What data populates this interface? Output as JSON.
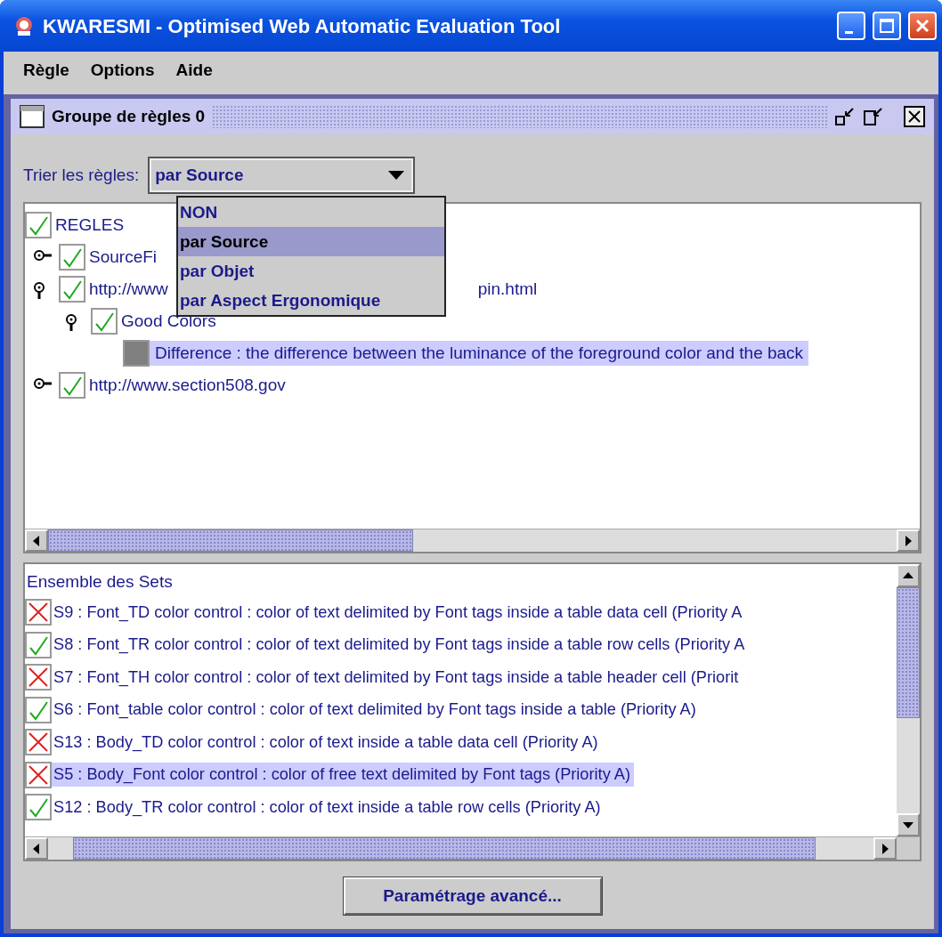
{
  "window": {
    "title": "KWARESMI - Optimised Web Automatic Evaluation Tool"
  },
  "menu": [
    "Règle",
    "Options",
    "Aide"
  ],
  "frame": {
    "title": "Groupe de règles 0"
  },
  "sort": {
    "label": "Trier les règles:",
    "value": "par Source",
    "expanded": true,
    "options": [
      {
        "label": "NON",
        "selected": false
      },
      {
        "label": "par Source",
        "selected": true
      },
      {
        "label": "par Objet",
        "selected": false
      },
      {
        "label": "par Aspect Ergonomique",
        "selected": false
      }
    ]
  },
  "tree": {
    "label": "REGLES",
    "passed": true,
    "selected": false,
    "children": [
      {
        "label": "SourceFi",
        "passed": true,
        "selected": false,
        "expanded": false
      },
      {
        "label": "http://www",
        "label_after": "pin.html",
        "passed": true,
        "selected": false,
        "expanded": true,
        "children": [
          {
            "label": "Good Colors",
            "passed": true,
            "selected": false,
            "expanded": true,
            "children": [
              {
                "label": "Difference : the difference between the luminance of the foreground color and the back",
                "greyed": true,
                "selected": true
              }
            ]
          }
        ]
      },
      {
        "label": "http://www.section508.gov",
        "passed": true,
        "selected": false,
        "expanded": false
      }
    ]
  },
  "sets": {
    "title": "Ensemble des Sets",
    "items": [
      {
        "label": "S9 : Font_TD color control : color of text delimited by Font tags inside a table data cell (Priority A",
        "passed": false,
        "selected": false
      },
      {
        "label": "S8 : Font_TR color control : color of text delimited by Font tags inside a table row cells (Priority A",
        "passed": true,
        "selected": false
      },
      {
        "label": "S7 : Font_TH color control : color of text delimited by Font tags inside a table header cell (Priorit",
        "passed": false,
        "selected": false
      },
      {
        "label": "S6 : Font_table color control : color of text delimited by Font tags inside a table (Priority A)",
        "passed": true,
        "selected": false
      },
      {
        "label": "S13 : Body_TD color control : color of text inside a table data cell (Priority A)",
        "passed": false,
        "selected": false
      },
      {
        "label": "S5 : Body_Font color control : color of free text delimited by Font tags (Priority A)",
        "passed": false,
        "selected": true
      },
      {
        "label": "S12 : Body_TR color control : color of text inside a table row cells (Priority A)",
        "passed": true,
        "selected": false
      }
    ]
  },
  "button": "Paramétrage avancé..."
}
